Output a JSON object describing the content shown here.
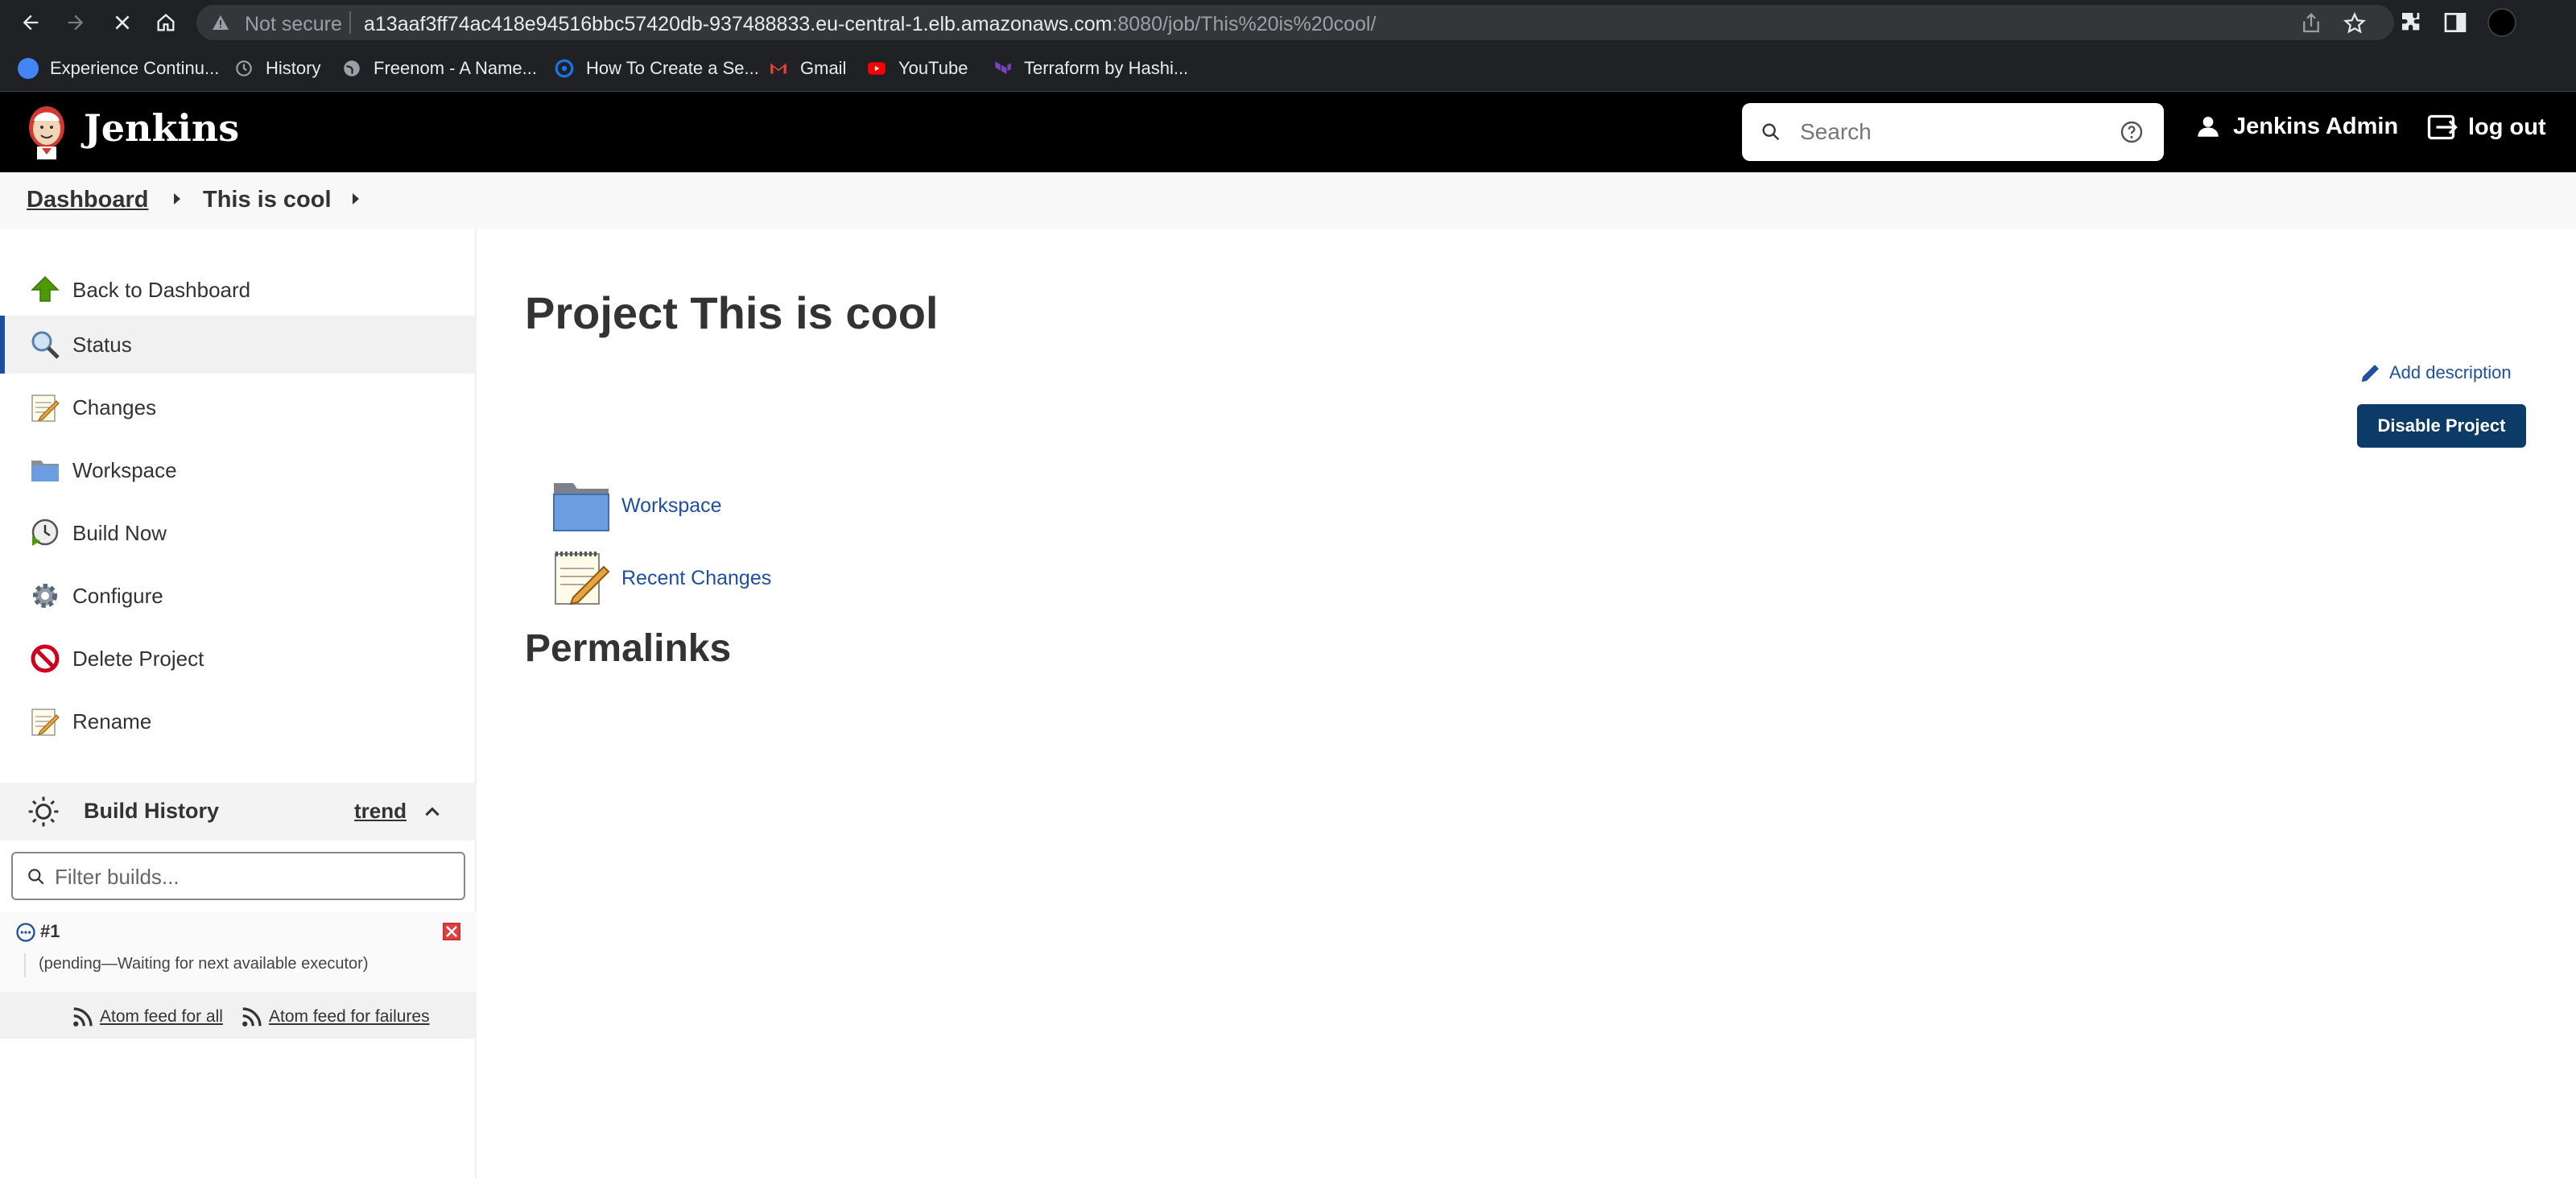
{
  "browser": {
    "not_secure": "Not secure",
    "url_host": "a13aaf3ff74ac418e94516bbc57420db-937488833.eu-central-1.elb.amazonaws.com",
    "url_path": ":8080/job/This%20is%20cool/"
  },
  "bookmarks": [
    {
      "label": "Experience Continu...",
      "icon": "experience-icon",
      "color": "#4285f4"
    },
    {
      "label": "History",
      "icon": "history-icon",
      "color": "#9aa0a6"
    },
    {
      "label": "Freenom - A Name...",
      "icon": "globe-icon",
      "color": "#9aa0a6"
    },
    {
      "label": "How To Create a Se...",
      "icon": "site-icon",
      "color": "#1a73e8"
    },
    {
      "label": "Gmail",
      "icon": "gmail-icon",
      "color": "#ea4335"
    },
    {
      "label": "YouTube",
      "icon": "youtube-icon",
      "color": "#ff0000"
    },
    {
      "label": "Terraform by Hashi...",
      "icon": "terraform-icon",
      "color": "#7b42bc"
    }
  ],
  "header": {
    "app_title": "Jenkins",
    "search_placeholder": "Search",
    "user_name": "Jenkins Admin",
    "logout_label": "log out"
  },
  "breadcrumb": {
    "dashboard": "Dashboard",
    "job": "This is cool"
  },
  "sidebar": {
    "items": [
      {
        "label": "Back to Dashboard",
        "icon": "arrow-up-icon"
      },
      {
        "label": "Status",
        "icon": "magnifier-icon",
        "active": true
      },
      {
        "label": "Changes",
        "icon": "notepad-icon"
      },
      {
        "label": "Workspace",
        "icon": "folder-icon"
      },
      {
        "label": "Build Now",
        "icon": "clock-play-icon"
      },
      {
        "label": "Configure",
        "icon": "gear-icon"
      },
      {
        "label": "Delete Project",
        "icon": "no-entry-icon"
      },
      {
        "label": "Rename",
        "icon": "notepad-icon"
      }
    ]
  },
  "build_history": {
    "title": "Build History",
    "trend": "trend",
    "filter_placeholder": "Filter builds...",
    "builds": [
      {
        "number": "#1",
        "status_text": "(pending—Waiting for next available executor)"
      }
    ],
    "atom_all": "Atom feed for all",
    "atom_failures": "Atom feed for failures"
  },
  "main": {
    "title": "Project This is cool",
    "add_description": "Add description",
    "disable_button": "Disable Project",
    "links": [
      {
        "label": "Workspace",
        "icon": "folder-icon"
      },
      {
        "label": "Recent Changes",
        "icon": "notepad-icon"
      }
    ],
    "permalinks_heading": "Permalinks"
  },
  "colors": {
    "header_bg": "#000000",
    "link": "#1e4fa3",
    "primary_button": "#0b3b66"
  }
}
